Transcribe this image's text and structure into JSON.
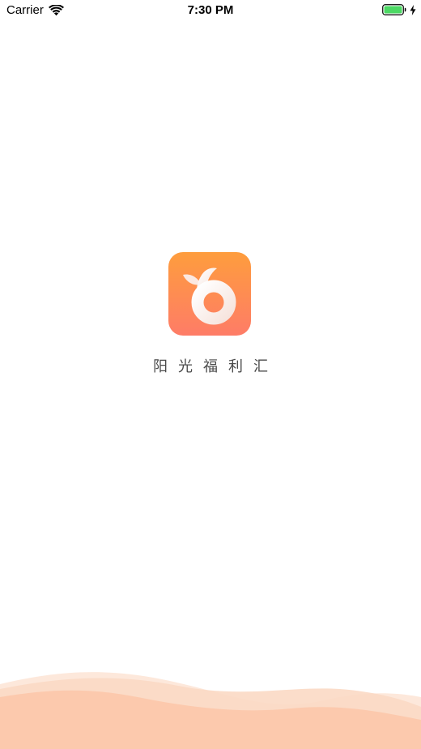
{
  "status_bar": {
    "carrier": "Carrier",
    "time": "7:30 PM",
    "battery_level": 1.0,
    "charging": true,
    "battery_color": "#4cd964"
  },
  "splash": {
    "app_name": "阳光福利汇",
    "logo_icon": "sunshine-logo-icon",
    "logo_gradient": [
      "#fe9d3d",
      "#fe7c67"
    ]
  },
  "decor": {
    "wave_colors": [
      "#fbd9c4",
      "#fde6d7",
      "#fcc6a8"
    ]
  }
}
